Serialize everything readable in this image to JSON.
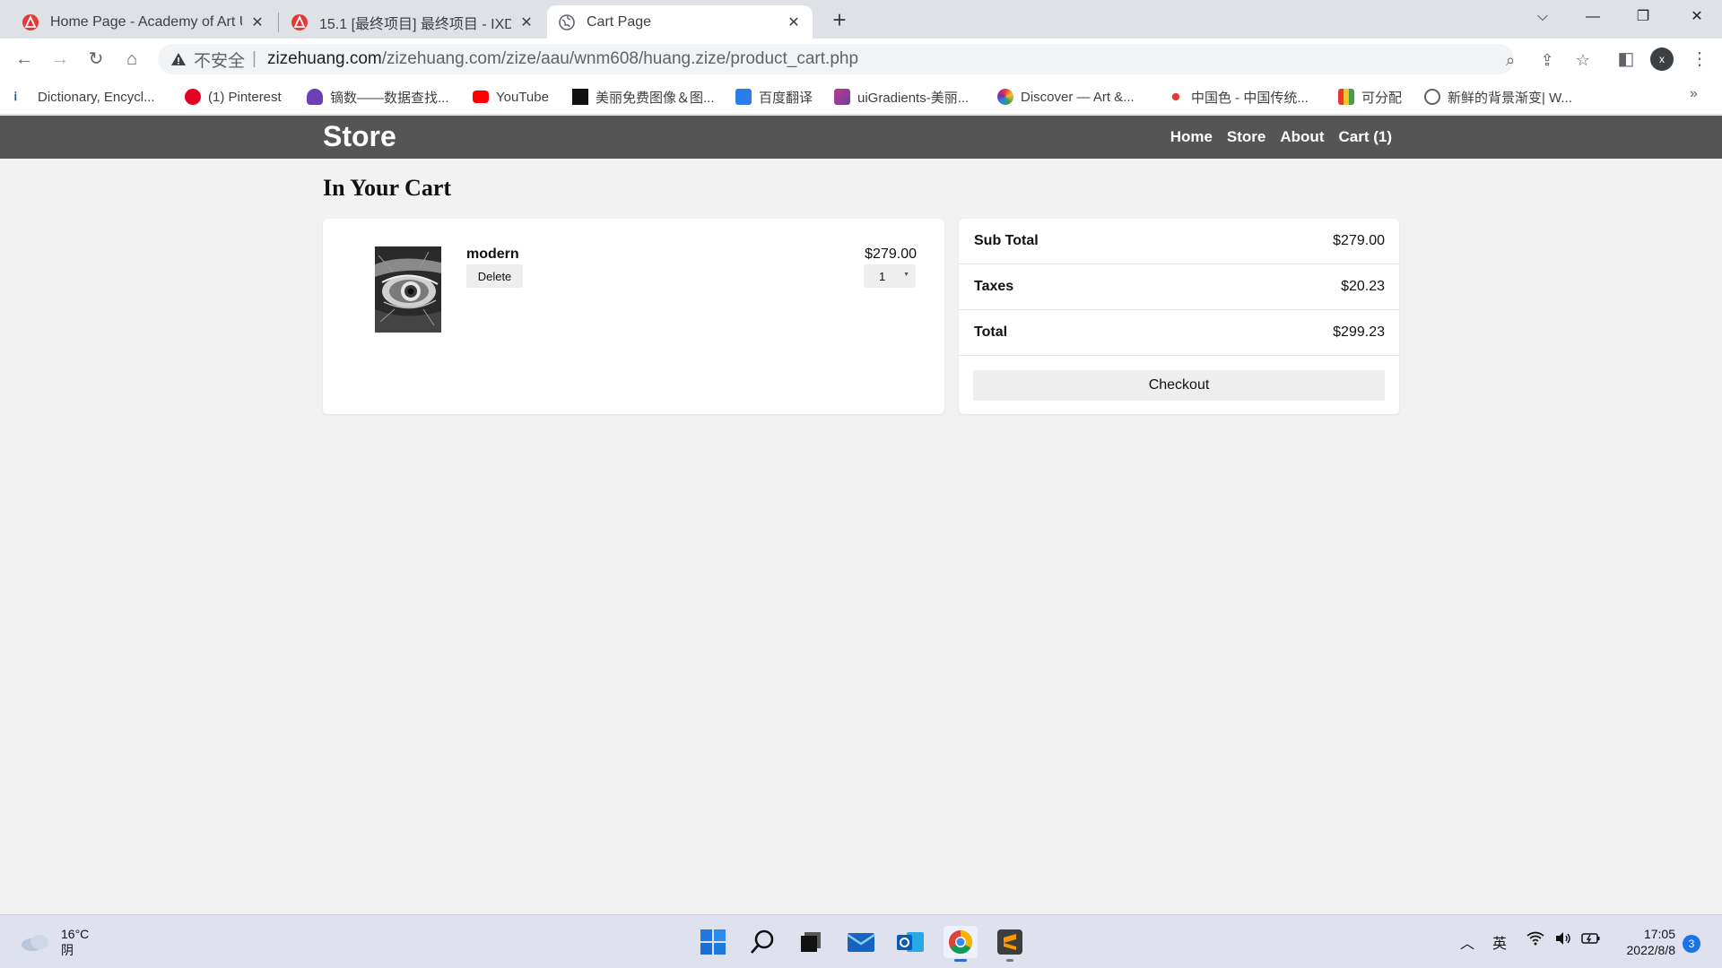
{
  "browser": {
    "tabs": [
      {
        "title": "Home Page - Academy of Art U",
        "icon": "academy-of-art-icon",
        "active": false
      },
      {
        "title": "15.1 [最终项目] 最终项目 - IXD_",
        "icon": "academy-of-art-icon",
        "active": false
      },
      {
        "title": "Cart Page",
        "icon": "globe-icon",
        "active": true
      }
    ],
    "address": {
      "security_label": "不安全",
      "separator": "|",
      "host": "zizehuang.com",
      "path": "/zizehuang.com/zize/aau/wnm608/huang.zize/product_cart.php"
    },
    "profile_initial": "x",
    "bookmarks": [
      {
        "label": "Dictionary, Encycl...",
        "icon": "dictionary-icon"
      },
      {
        "label": "(1) Pinterest",
        "icon": "pinterest-icon"
      },
      {
        "label": "镝数——数据查找...",
        "icon": "dishu-icon"
      },
      {
        "label": "YouTube",
        "icon": "youtube-icon"
      },
      {
        "label": "美丽免费图像＆图...",
        "icon": "unsplash-icon"
      },
      {
        "label": "百度翻译",
        "icon": "baidu-translate-icon"
      },
      {
        "label": "uiGradients-美丽...",
        "icon": "uigradients-icon"
      },
      {
        "label": "Discover — Art &...",
        "icon": "discover-icon"
      },
      {
        "label": "中国色 - 中国传统...",
        "icon": "zhongguose-icon"
      },
      {
        "label": "可分配",
        "icon": "kefenpei-icon"
      },
      {
        "label": "新鲜的背景渐变| W...",
        "icon": "globe-icon"
      }
    ]
  },
  "site": {
    "brand": "Store",
    "nav": [
      "Home",
      "Store",
      "About",
      "Cart (1)"
    ],
    "page_title": "In Your Cart",
    "cart_items": [
      {
        "name": "modern",
        "delete_label": "Delete",
        "price": "$279.00",
        "quantity": "1"
      }
    ],
    "summary": {
      "rows": [
        {
          "label": "Sub Total",
          "value": "$279.00"
        },
        {
          "label": "Taxes",
          "value": "$20.23"
        },
        {
          "label": "Total",
          "value": "$299.23"
        }
      ],
      "checkout_label": "Checkout"
    }
  },
  "taskbar": {
    "weather": {
      "temp": "16°C",
      "condition": "阴"
    },
    "ime": "英",
    "time": "17:05",
    "date": "2022/8/8",
    "notifications": "3"
  },
  "colors": {
    "site_nav": "#555555",
    "page_bg": "#f2f2f2",
    "button_bg": "#eeeeee"
  }
}
